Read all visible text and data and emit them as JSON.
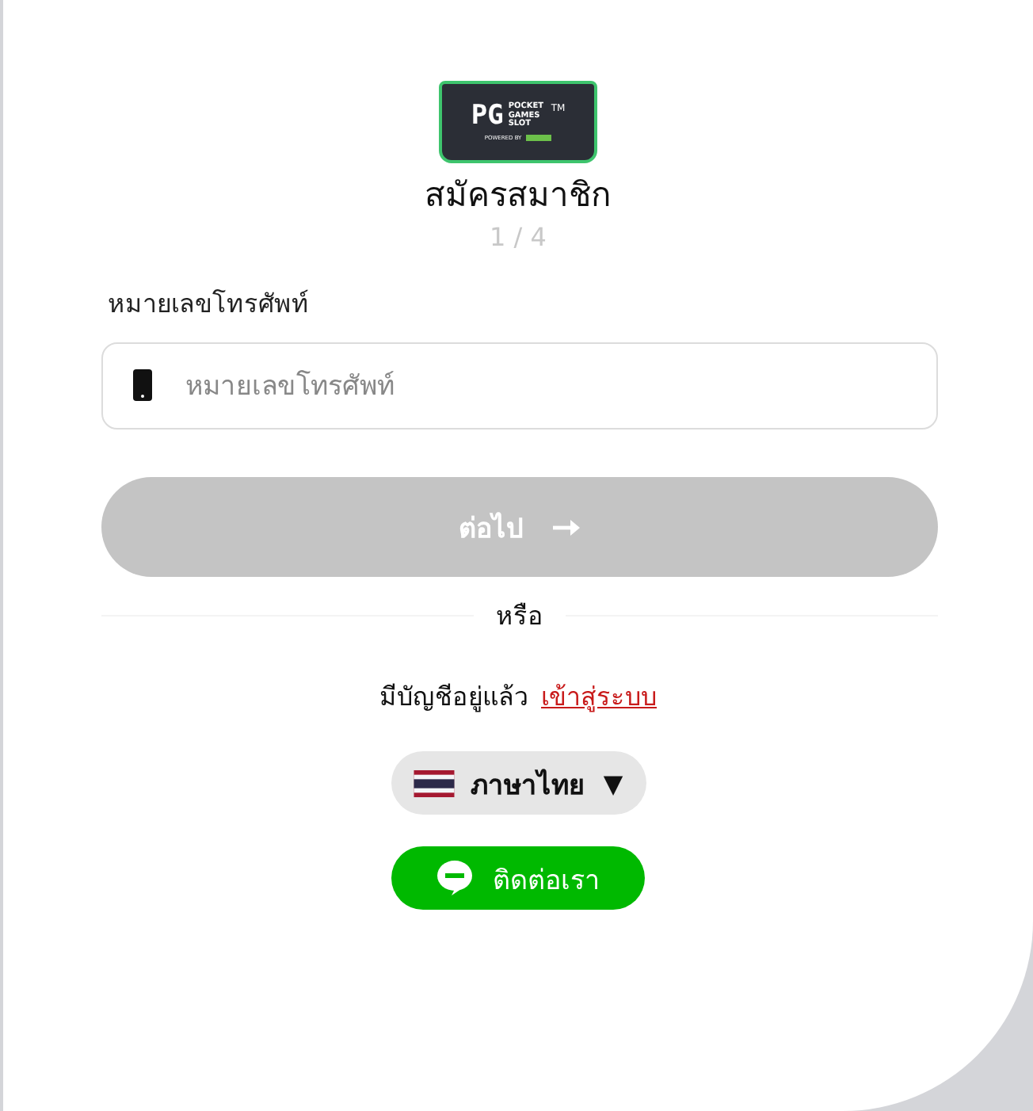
{
  "logo": {
    "mark": "PG",
    "name": "POCKET GAMES SLOT",
    "tm": "TM",
    "powered": "POWERED BY"
  },
  "title": "สมัครสมาชิก",
  "step": "1 / 4",
  "phone": {
    "label": "หมายเลขโทรศัพท์",
    "placeholder": "หมายเลขโทรศัพท์"
  },
  "next_button": {
    "label": "ต่อไป",
    "disabled": true
  },
  "divider": "หรือ",
  "login": {
    "text": "มีบัญชีอยู่แล้ว",
    "link": "เข้าสู่ระบบ"
  },
  "language": {
    "label": "ภาษาไทย",
    "caret": "▼"
  },
  "contact_button": {
    "label": "ติดต่อเรา"
  }
}
